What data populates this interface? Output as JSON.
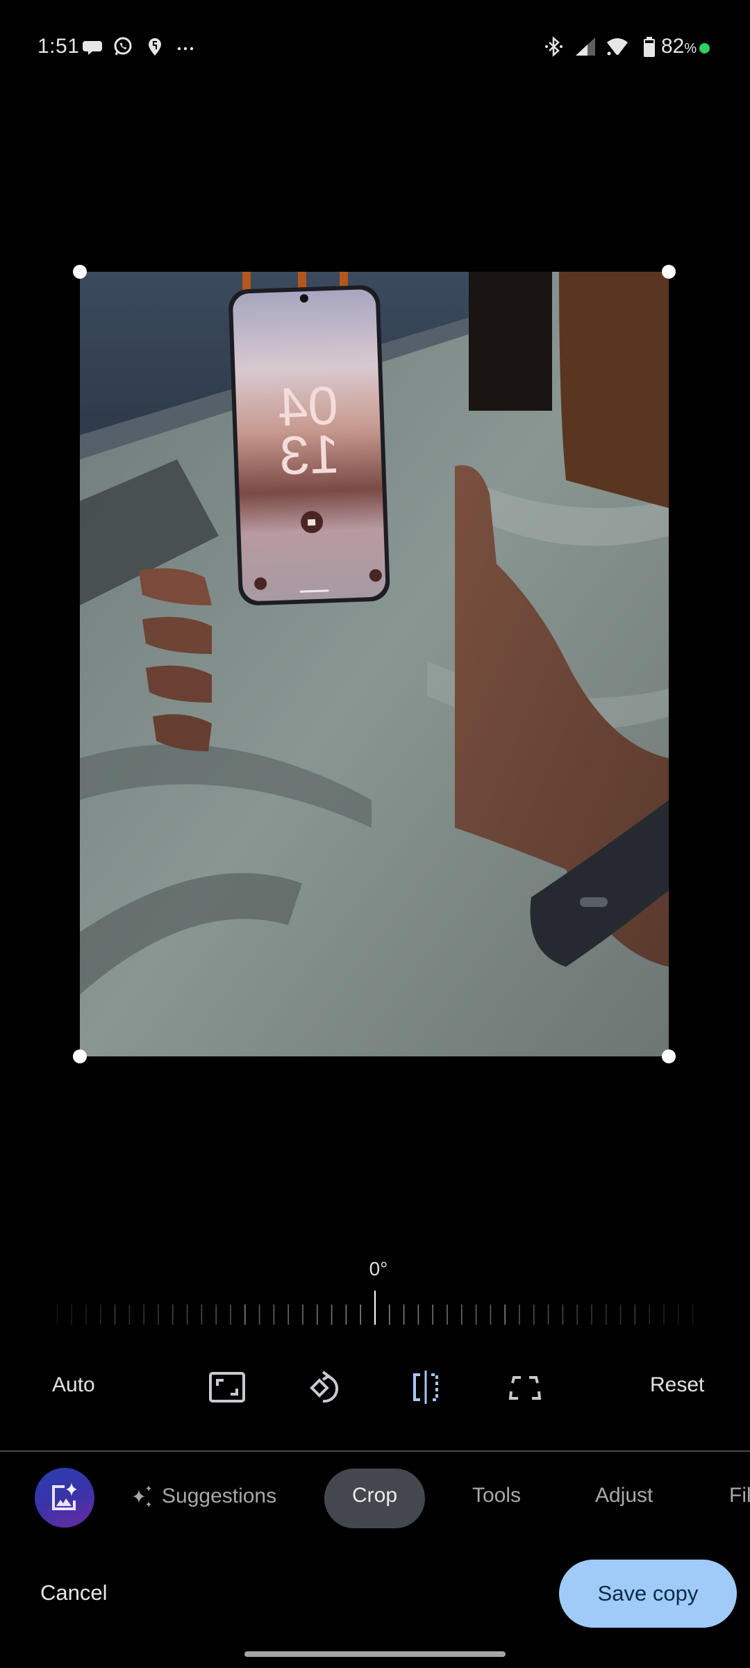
{
  "status_bar": {
    "time": "1:51",
    "notification_icons": [
      "messages-icon",
      "whatsapp-icon",
      "swiggy-icon",
      "more-notifications-icon"
    ],
    "system_icons": [
      "bluetooth-icon",
      "signal-icon",
      "wifi-icon",
      "battery-icon"
    ],
    "battery_percent": "82",
    "battery_unit": "%",
    "privacy_indicator_color": "#2fcf6a"
  },
  "editor": {
    "photo_description": "Hand holding a smartphone showing lock screen with clock 04 13 over a marble floor",
    "photo_lockscreen_clock": [
      "04",
      "13"
    ],
    "rotation": {
      "angle_label": "0°",
      "angle_value": 0
    },
    "crop_tools": {
      "auto_label": "Auto",
      "reset_label": "Reset",
      "icons": [
        "aspect-ratio-icon",
        "rotate-icon",
        "flip-icon",
        "perspective-icon"
      ],
      "active_icon": "flip-icon",
      "active_color": "#a8c7fa"
    }
  },
  "tabs": {
    "items": [
      {
        "label": "Suggestions",
        "icon": "sparkle-icon",
        "active": false
      },
      {
        "label": "Crop",
        "active": true
      },
      {
        "label": "Tools",
        "active": false
      },
      {
        "label": "Adjust",
        "active": false
      },
      {
        "label": "Fil",
        "active": false
      }
    ]
  },
  "actions": {
    "cancel_label": "Cancel",
    "save_label": "Save copy",
    "save_color": "#a0cbf8"
  }
}
